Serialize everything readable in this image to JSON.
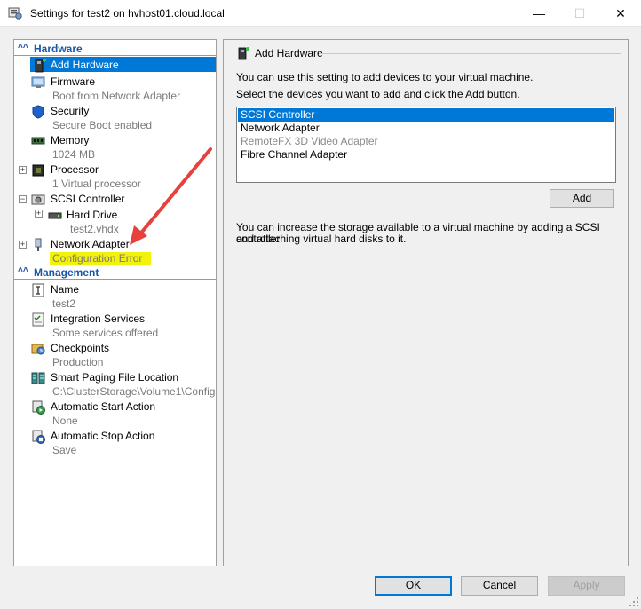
{
  "window": {
    "title": "Settings for test2 on hvhost01.cloud.local",
    "minimize": "—",
    "maximize": "☐",
    "close": "✕"
  },
  "sidebar": {
    "hardware_header": "Hardware",
    "management_header": "Management",
    "hardware_items": [
      {
        "label": "Add Hardware",
        "sub": ""
      },
      {
        "label": "Firmware",
        "sub": "Boot from Network Adapter"
      },
      {
        "label": "Security",
        "sub": "Secure Boot enabled"
      },
      {
        "label": "Memory",
        "sub": "1024 MB"
      },
      {
        "label": "Processor",
        "sub": "1 Virtual processor"
      },
      {
        "label": "SCSI Controller",
        "sub": ""
      },
      {
        "label": "Hard Drive",
        "sub": "test2.vhdx"
      },
      {
        "label": "Network Adapter",
        "sub": "Configuration Error"
      }
    ],
    "management_items": [
      {
        "label": "Name",
        "sub": "test2"
      },
      {
        "label": "Integration Services",
        "sub": "Some services offered"
      },
      {
        "label": "Checkpoints",
        "sub": "Production"
      },
      {
        "label": "Smart Paging File Location",
        "sub": "C:\\ClusterStorage\\Volume1\\Config"
      },
      {
        "label": "Automatic Start Action",
        "sub": "None"
      },
      {
        "label": "Automatic Stop Action",
        "sub": "Save"
      }
    ]
  },
  "main": {
    "title": "Add Hardware",
    "intro": "You can use this setting to add devices to your virtual machine.",
    "instruction": "Select the devices you want to add and click the Add button.",
    "devices": [
      {
        "label": "SCSI Controller",
        "state": "selected"
      },
      {
        "label": "Network Adapter",
        "state": "normal"
      },
      {
        "label": "RemoteFX 3D Video Adapter",
        "state": "disabled"
      },
      {
        "label": "Fibre Channel Adapter",
        "state": "normal"
      }
    ],
    "add_label": "Add",
    "storage_line1": "You can increase the storage available to a virtual machine by adding a SCSI controller",
    "storage_line2": "and attaching virtual hard disks to it."
  },
  "footer": {
    "ok": "OK",
    "cancel": "Cancel",
    "apply": "Apply"
  },
  "colors": {
    "selection": "#0078d7",
    "highlight": "#f2f20a",
    "annotation_arrow": "#e8403a",
    "header": "#1a56a6"
  }
}
